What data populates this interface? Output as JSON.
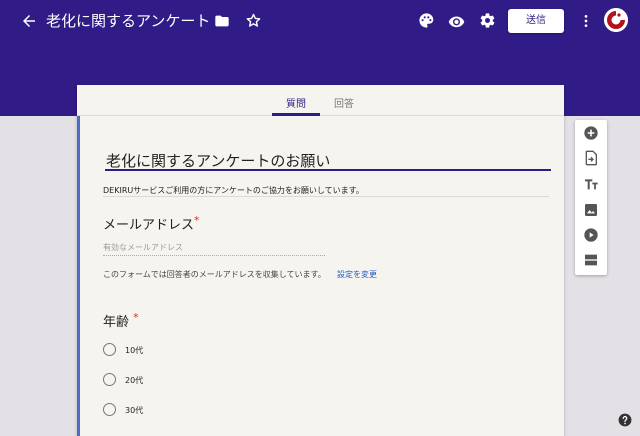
{
  "header": {
    "title": "老化に関するアンケート",
    "send_label": "送信"
  },
  "tabs": {
    "questions": "質問",
    "answers": "回答"
  },
  "form": {
    "title": "老化に関するアンケートのお願い",
    "description": "DEKIRUサービスご利用の方にアンケートのご協力をお願いしています。",
    "email_label": "メールアドレス",
    "required_mark": "*",
    "email_placeholder": "有効なメールアドレス",
    "collect_note": "このフォームでは回答者のメールアドレスを収集しています。",
    "settings_link": "設定を変更",
    "age_label": "年齢",
    "age_options": [
      "10代",
      "20代",
      "30代"
    ]
  },
  "colors": {
    "header_bg": "#311b87",
    "required": "#d93025",
    "link": "#2457c5"
  },
  "icons": [
    "back-arrow-icon",
    "folder-icon",
    "star-icon",
    "palette-icon",
    "eye-icon",
    "gear-icon",
    "more-vert-icon",
    "add-question-icon",
    "import-questions-icon",
    "add-title-icon",
    "add-image-icon",
    "add-video-icon",
    "add-section-icon",
    "help-icon"
  ]
}
